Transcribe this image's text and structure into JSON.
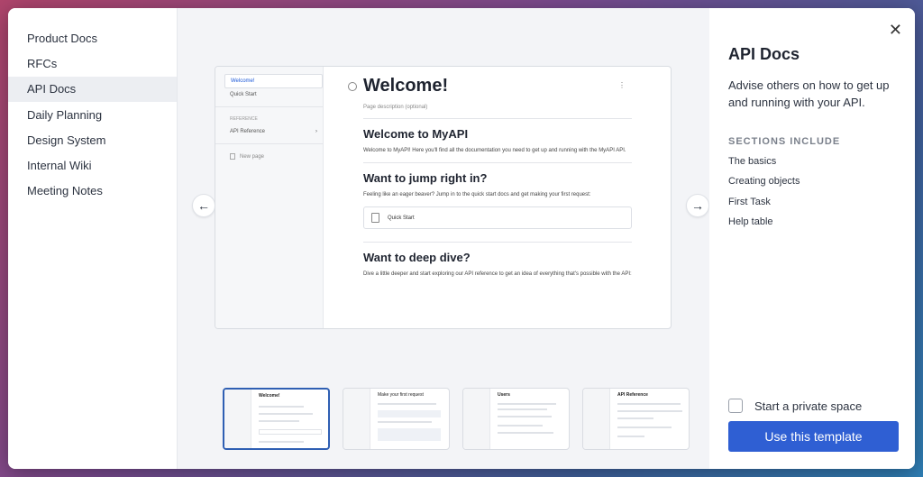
{
  "sidebar": {
    "items": [
      {
        "label": "Product Docs",
        "active": false
      },
      {
        "label": "RFCs",
        "active": false
      },
      {
        "label": "API Docs",
        "active": true
      },
      {
        "label": "Daily Planning",
        "active": false
      },
      {
        "label": "Design System",
        "active": false
      },
      {
        "label": "Internal Wiki",
        "active": false
      },
      {
        "label": "Meeting Notes",
        "active": false
      }
    ]
  },
  "preview": {
    "sidebar": {
      "active_item": "Welcome!",
      "quick_start": "Quick Start",
      "section_label": "REFERENCE",
      "api_reference": "API Reference",
      "new_page": "New page"
    },
    "page": {
      "title": "Welcome!",
      "description_placeholder": "Page description (optional)",
      "h_welcome": "Welcome to MyAPI",
      "p_welcome": "Welcome to MyAPI! Here you'll find all the documentation you need to get up and running with the MyAPI API.",
      "h_jump": "Want to jump right in?",
      "p_jump": "Feeling like an eager beaver? Jump in to the quick start docs and get making your first request:",
      "card_quick_start": "Quick Start",
      "h_deep": "Want to deep dive?",
      "p_deep": "Dive a little deeper and start exploring our API reference to get an idea of everything that's possible with the API:"
    }
  },
  "thumbnails": [
    {
      "title": "Welcome!",
      "active": true
    },
    {
      "title": "Make your first request",
      "active": false
    },
    {
      "title": "Users",
      "active": false
    },
    {
      "title": "API Reference",
      "active": false
    }
  ],
  "template": {
    "title": "API Docs",
    "description": "Advise others on how to get up and running with your API.",
    "sections_heading": "SECTIONS INCLUDE",
    "sections": [
      "The basics",
      "Creating objects",
      "First Task",
      "Help table"
    ],
    "private_space_label": "Start a private space",
    "use_button": "Use this template"
  },
  "colors": {
    "accent": "#2f5fd3",
    "active_bg": "#eceef2"
  }
}
